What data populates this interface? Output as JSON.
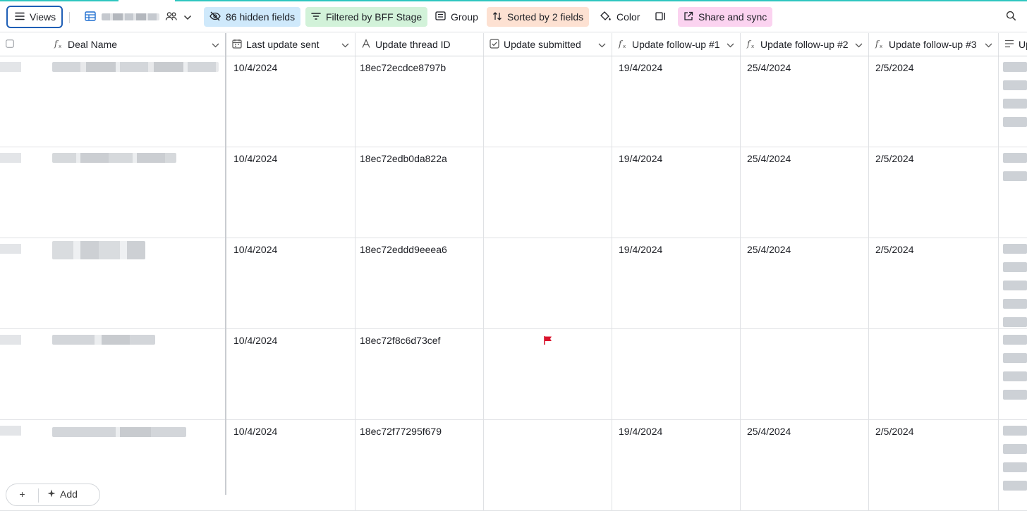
{
  "toolbar": {
    "views_label": "Views",
    "hidden_fields_label": "86 hidden fields",
    "filter_label": "Filtered by BFF Stage",
    "group_label": "Group",
    "sort_label": "Sorted by 2 fields",
    "color_label": "Color",
    "share_label": "Share and sync",
    "chip_colors": {
      "hidden": "#cfe9fb",
      "filter": "#d2f2d9",
      "sort": "#fde1d2",
      "share": "#fbd3f0"
    }
  },
  "columns": [
    {
      "name": "Deal Name",
      "icon": "formula-icon"
    },
    {
      "name": "Last update sent",
      "icon": "calendar-icon"
    },
    {
      "name": "Update thread ID",
      "icon": "text-icon"
    },
    {
      "name": "Update submitted",
      "icon": "checkbox-icon"
    },
    {
      "name": "Update follow-up #1",
      "icon": "formula-icon"
    },
    {
      "name": "Update follow-up #2",
      "icon": "formula-icon"
    },
    {
      "name": "Update follow-up #3",
      "icon": "formula-icon"
    },
    {
      "name": "Up",
      "icon": "long-text-icon"
    }
  ],
  "rows": [
    {
      "last_update_sent": "10/4/2024",
      "thread_id": "18ec72ecdce8797b",
      "submitted_flag": false,
      "followup1": "19/4/2024",
      "followup2": "25/4/2024",
      "followup3": "2/5/2024"
    },
    {
      "last_update_sent": "10/4/2024",
      "thread_id": "18ec72edb0da822a",
      "submitted_flag": false,
      "followup1": "19/4/2024",
      "followup2": "25/4/2024",
      "followup3": "2/5/2024"
    },
    {
      "last_update_sent": "10/4/2024",
      "thread_id": "18ec72eddd9eeea6",
      "submitted_flag": false,
      "followup1": "19/4/2024",
      "followup2": "25/4/2024",
      "followup3": "2/5/2024"
    },
    {
      "last_update_sent": "10/4/2024",
      "thread_id": "18ec72f8c6d73cef",
      "submitted_flag": true,
      "followup1": "",
      "followup2": "",
      "followup3": ""
    },
    {
      "last_update_sent": "10/4/2024",
      "thread_id": "18ec72f77295f679",
      "submitted_flag": false,
      "followup1": "19/4/2024",
      "followup2": "25/4/2024",
      "followup3": "2/5/2024"
    }
  ],
  "bottom": {
    "add_label": "Add"
  },
  "colors": {
    "accent_line": "#2ec6c0",
    "flag": "#d9142d",
    "views_border": "#1f5fb6"
  }
}
